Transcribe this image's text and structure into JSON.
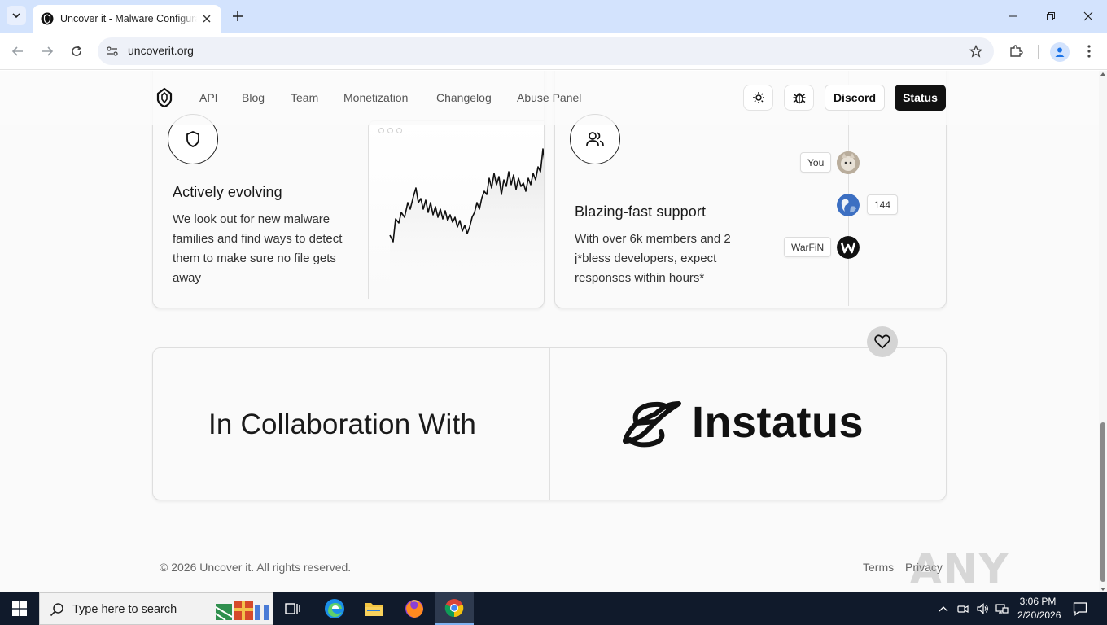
{
  "browser": {
    "tab_title": "Uncover it - Malware Configura",
    "url": "uncoverit.org"
  },
  "nav": {
    "links": [
      "API",
      "Blog",
      "Team",
      "Monetization",
      "Changelog",
      "Abuse Panel"
    ],
    "discord_label": "Discord",
    "status_label": "Status"
  },
  "feature_evolving": {
    "title": "Actively evolving",
    "description": "We look out for new malware families and find ways to detect them to make sure no file gets away",
    "icon": "shield-icon"
  },
  "feature_support": {
    "title": "Blazing-fast support",
    "description": "With over 6k members and 2 j*bless developers, expect responses within hours*",
    "icon": "users-icon",
    "chips": [
      "You",
      "144",
      "WarFiN"
    ]
  },
  "collaboration": {
    "heading": "In Collaboration With",
    "partner": "Instatus"
  },
  "footer": {
    "copyright": "© 2026 Uncover it. All rights reserved.",
    "terms": "Terms",
    "privacy": "Privacy",
    "watermark": "ANY RUN"
  },
  "taskbar": {
    "search_placeholder": "Type here to search",
    "time": "3:06 PM",
    "date": "2/20/2026"
  },
  "colors": {
    "tabstrip": "#d3e3fd",
    "page_bg": "#fafafa",
    "status_button": "#111111",
    "taskbar": "#101a2b"
  }
}
